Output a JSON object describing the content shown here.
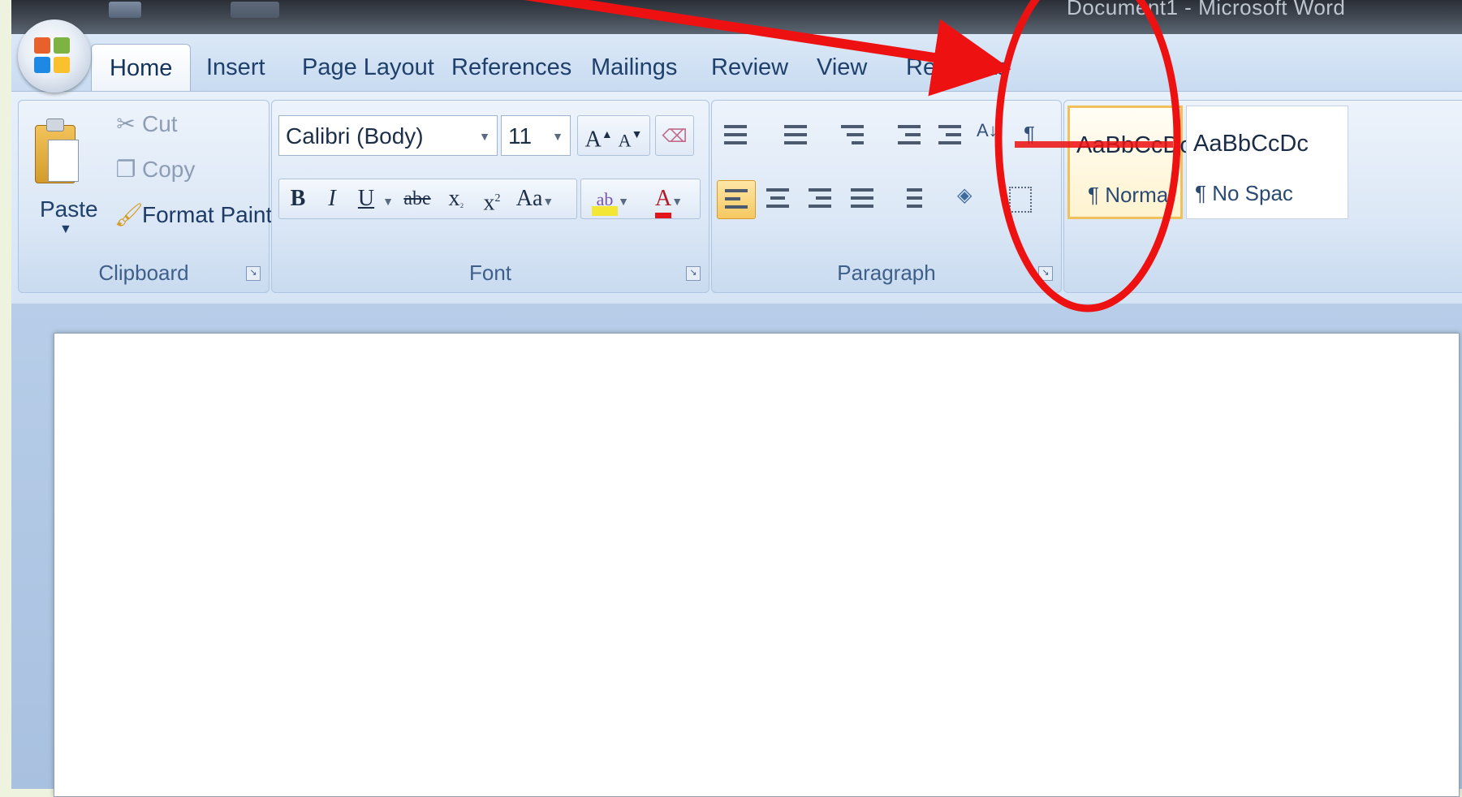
{
  "titlebar": {
    "title": "Document1 - Microsoft Word"
  },
  "tabs": [
    {
      "label": "Home",
      "active": true
    },
    {
      "label": "Insert",
      "active": false
    },
    {
      "label": "Page Layout",
      "active": false
    },
    {
      "label": "References",
      "active": false
    },
    {
      "label": "Mailings",
      "active": false
    },
    {
      "label": "Review",
      "active": false
    },
    {
      "label": "View",
      "active": false
    },
    {
      "label": "RefWorks",
      "active": false
    }
  ],
  "clipboard": {
    "paste_label": "Paste",
    "cut_label": "Cut",
    "copy_label": "Copy",
    "format_painter_label": "Format Painter",
    "group_label": "Clipboard"
  },
  "font": {
    "font_name": "Calibri (Body)",
    "font_size": "11",
    "grow": "A",
    "shrink": "A",
    "bold": "B",
    "italic": "I",
    "underline": "U",
    "strikethrough": "abe",
    "subscript": "x",
    "superscript": "x",
    "change_case": "Aa",
    "font_color": "A",
    "group_label": "Font"
  },
  "paragraph": {
    "group_label": "Paragraph"
  },
  "styles": [
    {
      "sample": "AaBbCcDc",
      "name": "¶ Normal",
      "selected": true
    },
    {
      "sample": "AaBbCcDc",
      "name": "¶ No Spac",
      "selected": false
    }
  ],
  "colors": {
    "annotation": "#ee1111",
    "tab_text": "#20406c",
    "highlight": "#f3e635",
    "font_color_bar": "#e4141b"
  },
  "icons": {
    "cut": "scissors-icon",
    "copy": "copy-icon",
    "format_painter": "paintbrush-icon",
    "clear_format": "eraser-icon"
  }
}
